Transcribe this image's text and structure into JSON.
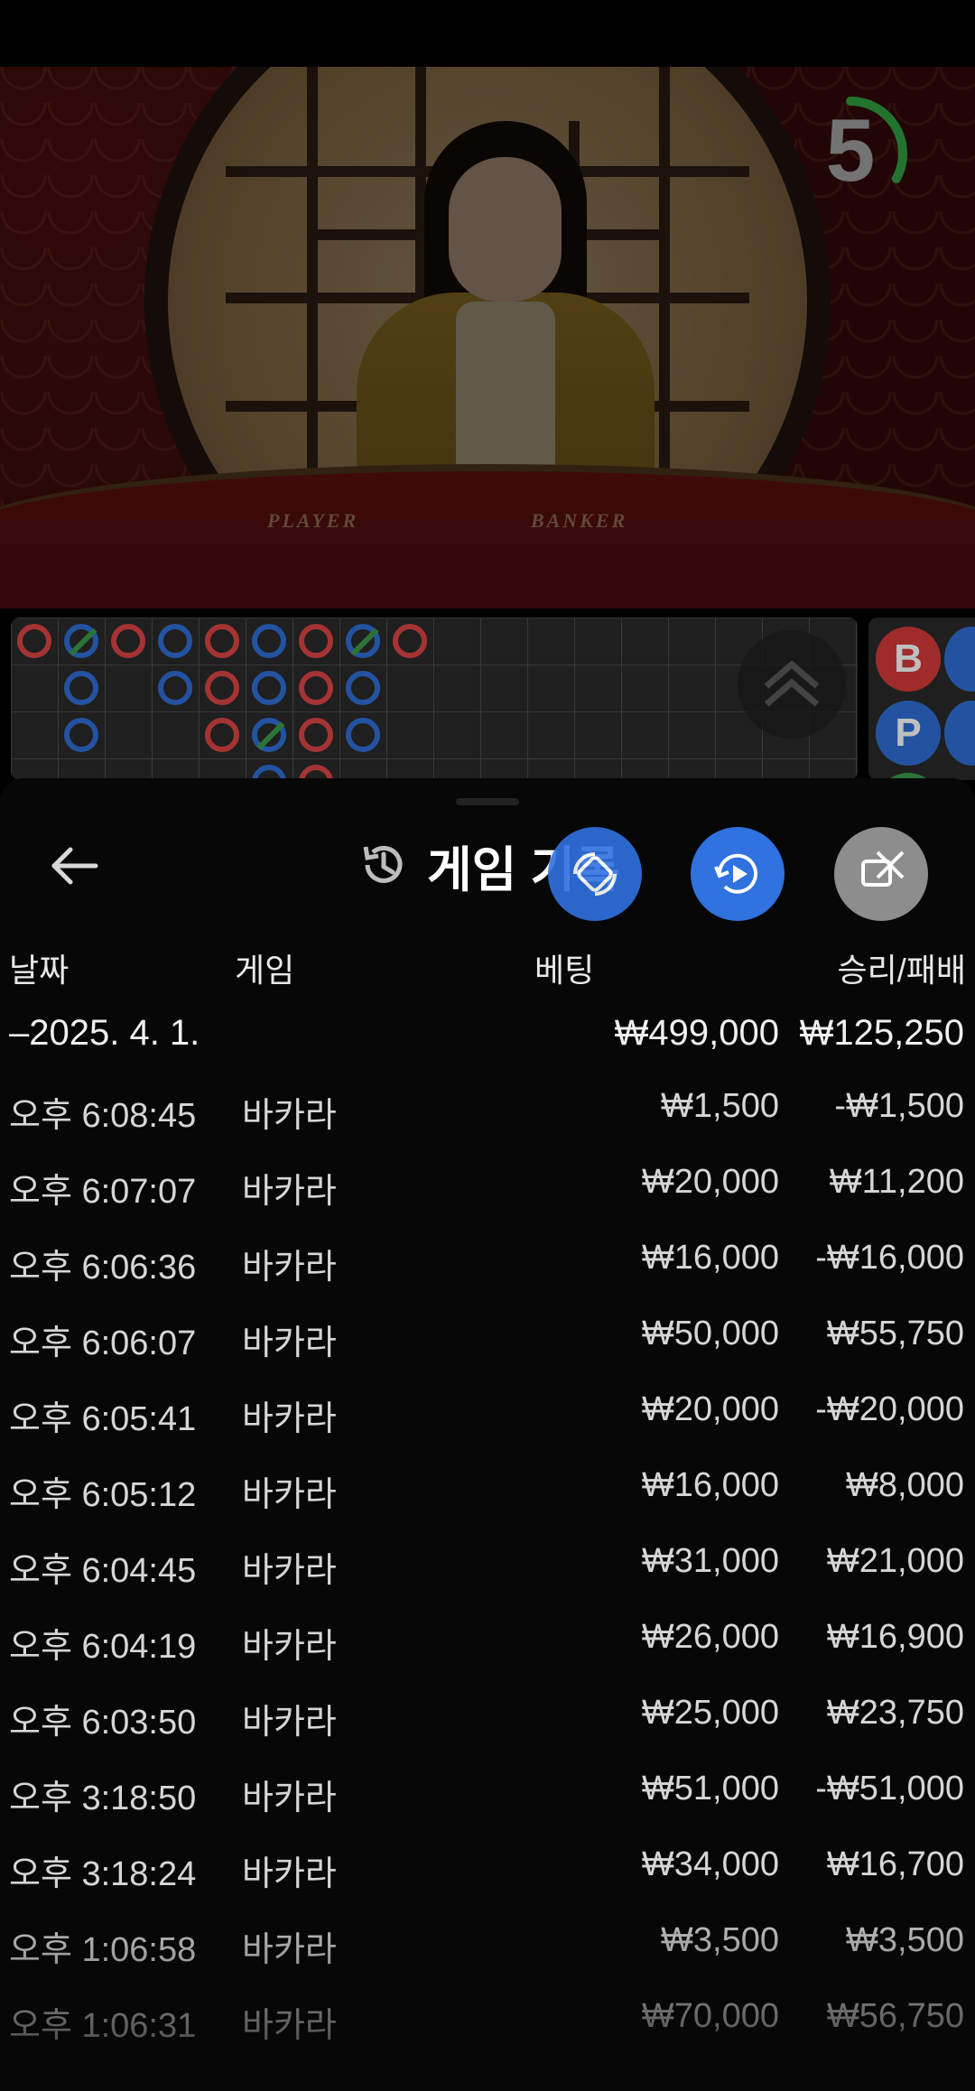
{
  "video": {
    "felt_left": "PLAYER",
    "felt_right": "BANKER",
    "countdown": "5",
    "countdown_fraction": 0.33,
    "countdown_color": "#2e9a3e"
  },
  "scoreboard": {
    "side_labels": [
      "B",
      "P"
    ],
    "banker_color": "#d63a3a",
    "player_color": "#2f6fd6",
    "tie_color": "#3a9a48"
  },
  "history": {
    "title": "게임 기록",
    "columns": {
      "date": "날짜",
      "game": "게임",
      "bet": "베팅",
      "result": "승리/패배"
    },
    "day": {
      "date": "–2025. 4. 1.",
      "total_bet": "₩499,000",
      "total_result": "₩125,250"
    },
    "rows": [
      {
        "time": "오후 6:08:45",
        "game": "바카라",
        "bet": "₩1,500",
        "result": "-₩1,500"
      },
      {
        "time": "오후 6:07:07",
        "game": "바카라",
        "bet": "₩20,000",
        "result": "₩11,200"
      },
      {
        "time": "오후 6:06:36",
        "game": "바카라",
        "bet": "₩16,000",
        "result": "-₩16,000"
      },
      {
        "time": "오후 6:06:07",
        "game": "바카라",
        "bet": "₩50,000",
        "result": "₩55,750"
      },
      {
        "time": "오후 6:05:41",
        "game": "바카라",
        "bet": "₩20,000",
        "result": "-₩20,000"
      },
      {
        "time": "오후 6:05:12",
        "game": "바카라",
        "bet": "₩16,000",
        "result": "₩8,000"
      },
      {
        "time": "오후 6:04:45",
        "game": "바카라",
        "bet": "₩31,000",
        "result": "₩21,000"
      },
      {
        "time": "오후 6:04:19",
        "game": "바카라",
        "bet": "₩26,000",
        "result": "₩16,900"
      },
      {
        "time": "오후 6:03:50",
        "game": "바카라",
        "bet": "₩25,000",
        "result": "₩23,750"
      },
      {
        "time": "오후 3:18:50",
        "game": "바카라",
        "bet": "₩51,000",
        "result": "-₩51,000"
      },
      {
        "time": "오후 3:18:24",
        "game": "바카라",
        "bet": "₩34,000",
        "result": "₩16,700"
      },
      {
        "time": "오후 1:06:58",
        "game": "바카라",
        "bet": "₩3,500",
        "result": "₩3,500"
      },
      {
        "time": "오후 1:06:31",
        "game": "바카라",
        "bet": "₩70,000",
        "result": "₩56,750"
      }
    ]
  },
  "icons": {
    "back": "arrow-left-icon",
    "history": "history-clock-icon",
    "rotate": "rotate-icon",
    "replay": "replay-icon",
    "close": "close-icon",
    "accent": "#2f72e0"
  }
}
